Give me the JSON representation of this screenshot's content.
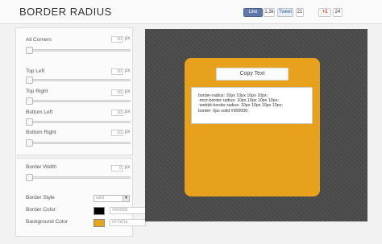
{
  "header": {
    "title": "BORDER RADIUS",
    "facebook": {
      "like_label": "Like",
      "count": "1,3k"
    },
    "twitter": {
      "tweet_label": "Tweet",
      "count": "21"
    },
    "gplus": {
      "label": "+1",
      "count": "24"
    }
  },
  "corners": {
    "all": {
      "label": "All Corners",
      "value": "10",
      "unit": "px"
    },
    "top_left": {
      "label": "Top Left",
      "value": "10",
      "unit": "px"
    },
    "top_right": {
      "label": "Top Right",
      "value": "10",
      "unit": "px"
    },
    "bottom_left": {
      "label": "Bottom Left",
      "value": "10",
      "unit": "px"
    },
    "bottom_right": {
      "label": "Bottom Right",
      "value": "10",
      "unit": "px"
    }
  },
  "border": {
    "width": {
      "label": "Border Width",
      "value": "0",
      "unit": "px"
    },
    "style": {
      "label": "Border Style",
      "value": "solid"
    },
    "color": {
      "label": "Border Color",
      "value": "#000000",
      "swatch": "#000000"
    },
    "background": {
      "label": "Background Color",
      "value": "#e7a61a",
      "swatch": "#e7a61a"
    }
  },
  "preview": {
    "copy_label": "Copy Text",
    "css_lines": [
      "border-radius: 10px 10px 10px 10px;",
      "-moz-border-radius: 10px 10px 10px 10px;",
      "-webkit-border-radius: 10px 10px 10px 10px;",
      "border: 0px solid #000000;"
    ]
  },
  "colors": {
    "preview_bg": "#4a4a4a",
    "box_color": "#e8a11c",
    "accent": "#5f78ab"
  }
}
